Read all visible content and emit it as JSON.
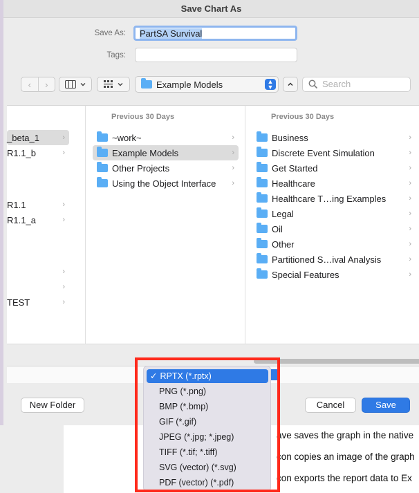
{
  "dialog": {
    "title": "Save Chart As",
    "save_as_label": "Save As:",
    "save_as_value": "PartSA Survival",
    "tags_label": "Tags:",
    "location": "Example Models",
    "search_placeholder": "Search",
    "new_folder_label": "New Folder",
    "cancel_label": "Cancel",
    "save_label": "Save"
  },
  "browser": {
    "col1_rows": [
      "_beta_1",
      "R1.1_b",
      "R1.1",
      "R1.1_a",
      "",
      "",
      "TEST"
    ],
    "col2_header": "Previous 30 Days",
    "col2_rows": [
      "~work~",
      "Example Models",
      "Other Projects",
      "Using the Object Interface"
    ],
    "col3_header": "Previous 30 Days",
    "col3_rows": [
      "Business",
      "Discrete Event Simulation",
      "Get Started",
      "Healthcare",
      "Healthcare T…ing Examples",
      "Legal",
      "Oil",
      "Other",
      "Partitioned S…ival Analysis",
      "Special Features"
    ]
  },
  "format_menu": {
    "items": [
      "RPTX (*.rptx)",
      "PNG (*.png)",
      "BMP (*.bmp)",
      "GIF (*.gif)",
      "JPEG (*.jpg; *.jpeg)",
      "TIFF (*.tif; *.tiff)",
      "SVG (vector) (*.svg)",
      "PDF (vector) (*.pdf)"
    ],
    "selected_check": "✓"
  },
  "background_doc": {
    "line1": "ave saves the graph in the native",
    "line2": "con copies an image of the graph",
    "line3": "con exports the report data to Ex"
  },
  "colors": {
    "accent": "#2f7ae5",
    "annotation_red": "#ff2a1c",
    "folder": "#5aaef5"
  }
}
